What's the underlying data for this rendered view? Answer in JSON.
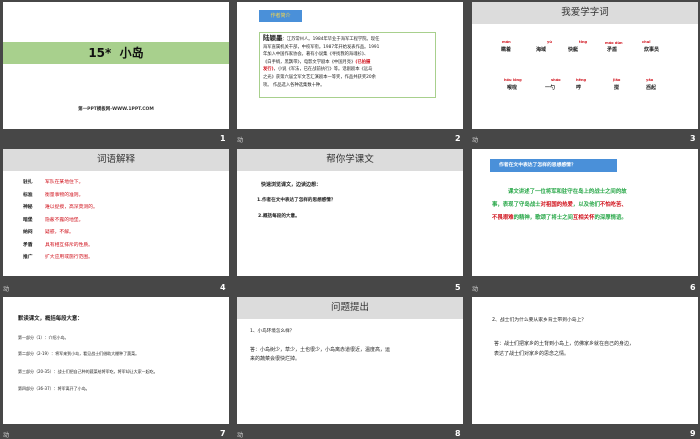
{
  "slides": [
    {
      "number": "1",
      "title": "15*  小岛",
      "footer": "第一PPT模板网-WWW.1PPT.COM"
    },
    {
      "number": "2",
      "anim_icon": "动",
      "tag": "作者简介",
      "author": "陆颖墨",
      "bio_1": "：江苏常州人。1984年毕业于海军工程学院。现任",
      "bio_2": "海军直属机关干部，中校军衔。1987年开始发表作品。1991",
      "bio_3": "年加入中国作家协会。著有小说集《寻找我的海魂衫》、",
      "bio_4": "《白手绢，黑飘带》，电影文学剧本《中国月亮》",
      "bio_red_1": "(已拍摄",
      "bio_red_2": "发行)",
      "bio_5": "，小说《军法，已在战前执行》等。话剧剧本《远岛",
      "bio_6": "之光》获第六届全军文艺汇演剧本一等奖，作品共获奖20余",
      "bio_7": "项。 作品选入各种选集数十种。"
    },
    {
      "number": "3",
      "anim_icon": "动",
      "title": "我爱学字词",
      "words": [
        {
          "pinyin": "mán",
          "word": "瞒着"
        },
        {
          "pinyin": "yù",
          "word": "海域"
        },
        {
          "pinyin": "tǐng",
          "word": "快艇"
        },
        {
          "pinyin": "máo dùn",
          "word": "矛盾"
        },
        {
          "pinyin": "chuī",
          "word": "炊事员"
        },
        {
          "pinyin": "hóu lóng",
          "word": "喉咙"
        },
        {
          "pinyin": "sháo",
          "word": "一勺"
        },
        {
          "pinyin": "hēng",
          "word": "哼"
        },
        {
          "pinyin": "jiǎo",
          "word": "搅"
        },
        {
          "pinyin": "yǎo",
          "word": "舀起"
        }
      ]
    },
    {
      "number": "4",
      "anim_icon": "动",
      "title": "词语解释",
      "terms": [
        {
          "term": "驻扎",
          "def": "军队在某地住下。"
        },
        {
          "term": "标准",
          "def": "衡量事物的准则。"
        },
        {
          "term": "神秘",
          "def": "难以捉摸，高深莫测的。"
        },
        {
          "term": "暗堡",
          "def": "隐蔽不露的地堡。"
        },
        {
          "term": "纳闷",
          "def": "疑惑，不解。"
        },
        {
          "term": "矛盾",
          "def": "具有相互排斥的性质。"
        },
        {
          "term": "推广",
          "def": "扩大应用或施行范围。"
        }
      ]
    },
    {
      "number": "5",
      "title": "帮你学课文",
      "intro": "快速浏览课文，边读边想：",
      "q1": "1.作者在文中表达了怎样的思想感情？",
      "q2": "2.概括每段的大意。"
    },
    {
      "number": "6",
      "anim_icon": "动",
      "tag": "作者在文中表达了怎样的思想感情？",
      "p1": "课文讲述了一位将军和驻守在岛上的战士之间的故",
      "p2a": "事，表现了守岛战士",
      "p2b": "对祖国的热爱",
      "p2c": "，以及他们",
      "p2d": "不怕吃苦、",
      "p3a": "不畏艰难",
      "p3b": "的精神，歌颂了将士之间",
      "p3c": "互相关怀",
      "p3d": "的深厚情谊。"
    },
    {
      "number": "7",
      "anim_icon": "动",
      "heading": "默读课文，概括每段大意：",
      "parts": [
        "第一部分（1）：介绍小岛。",
        "第二部分（2-19）：将军来到小岛，看见战士们借助大棚种了蔬菜。",
        "第三部分（20-35）：战士们把自己种的蔬菜给将军吃，将军却让大家一起吃。",
        "第四部分（36-37）：将军离开了小岛。"
      ]
    },
    {
      "number": "8",
      "anim_icon": "动",
      "title": "问题提出",
      "q": "1、小岛环境怎么样？",
      "a1": "答：小岛树少，草少，土也很少，小岛离赤道很近，温度高，运",
      "a2": "来的蔬菜会很快烂掉。"
    },
    {
      "number": "9",
      "q": "2、战士们为什么要从家乡背土带到小岛上？",
      "a1": "答：战士们把家乡的土背到小岛上，仿佛家乡就在自己的身边，",
      "a2": "表达了战士们对家乡的思念之情。"
    }
  ],
  "colors": {
    "green_band": "#a8d08d",
    "blue_tag": "#4a90d9",
    "red": "#d0111b",
    "green_text": "#2aa84a"
  }
}
